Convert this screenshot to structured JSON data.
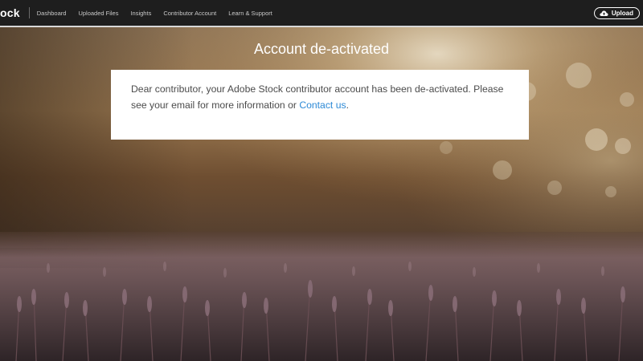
{
  "header": {
    "brand": "ock",
    "nav_items": [
      "Dashboard",
      "Uploaded Files",
      "Insights",
      "Contributor Account",
      "Learn & Support"
    ],
    "upload_label": "Upload",
    "upload_icon": "cloud-upload-icon"
  },
  "main": {
    "title": "Account de-activated",
    "message_prefix": "Dear contributor, your Adobe Stock contributor account has been de-activated. Please see your email for more information or ",
    "contact_link": "Contact us",
    "message_suffix": "."
  },
  "colors": {
    "topbar": "#1e1e1e",
    "link": "#2d8ad6",
    "card": "#ffffff",
    "text": "#4b4b4b"
  }
}
